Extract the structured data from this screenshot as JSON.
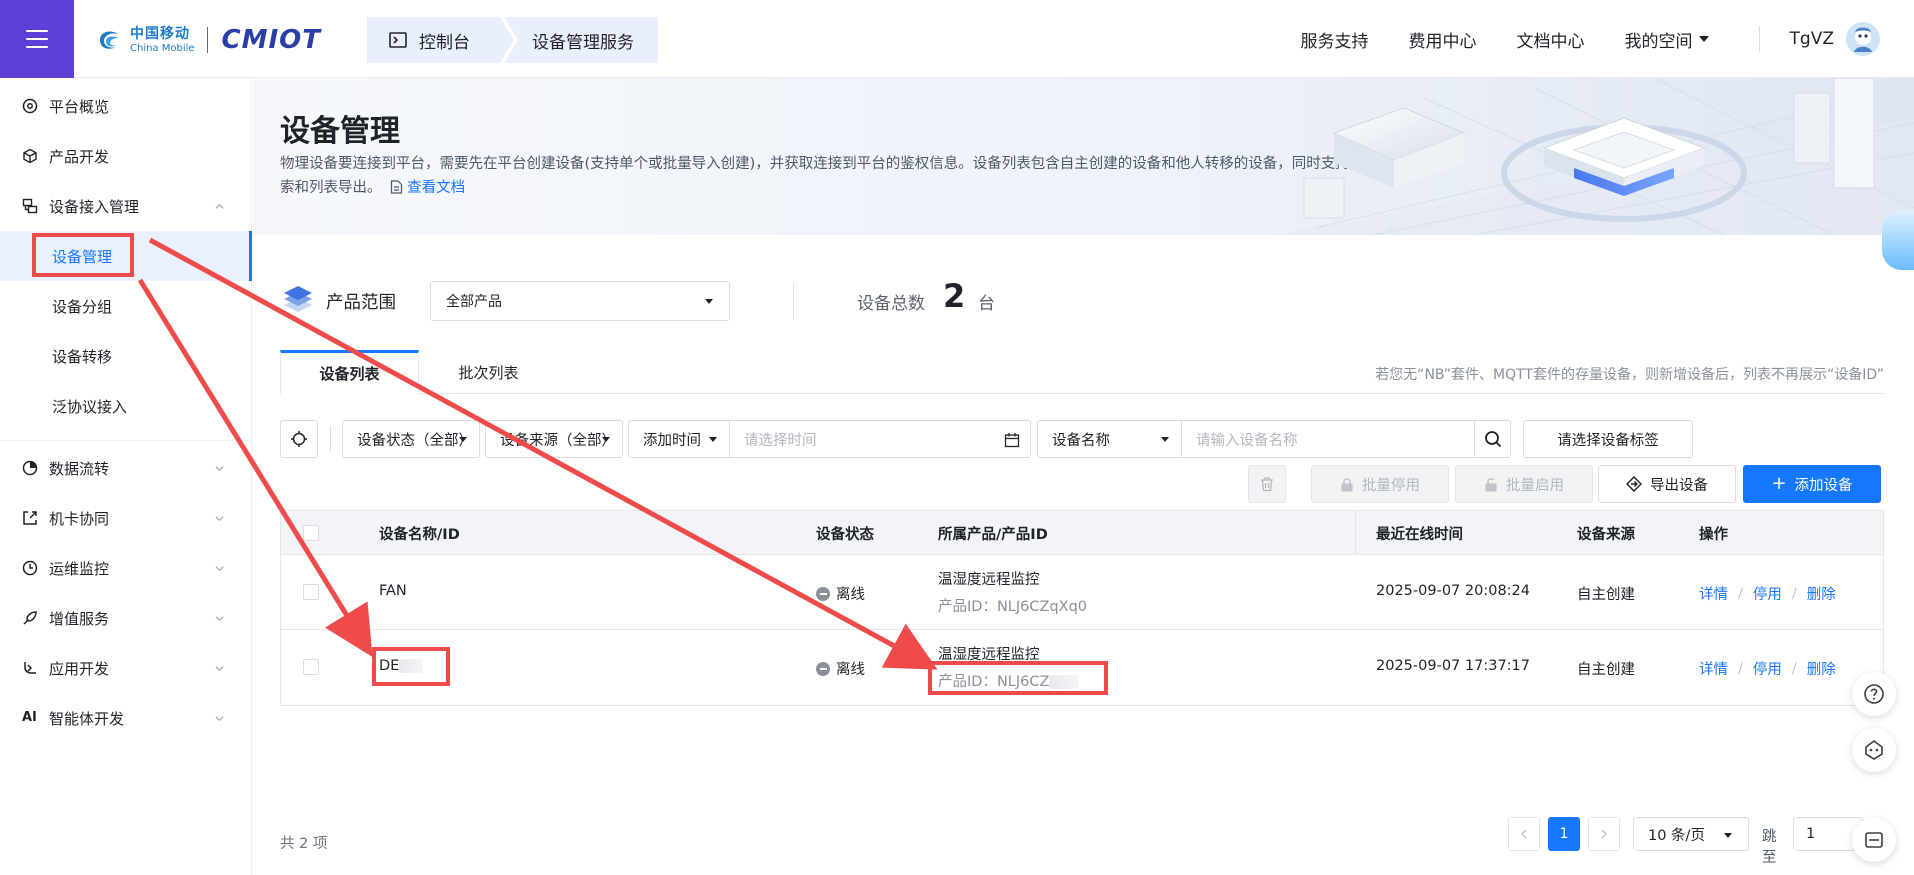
{
  "header": {
    "logo_cn": "中国移动",
    "logo_en": "China Mobile",
    "logo_product": "CMIOT",
    "breadcrumbs": [
      "控制台",
      "设备管理服务"
    ],
    "nav": [
      "服务支持",
      "费用中心",
      "文档中心",
      "我的空间"
    ],
    "username": "TgVZ"
  },
  "sidebar": {
    "items": [
      {
        "label": "平台概览",
        "icon": "overview-icon"
      },
      {
        "label": "产品开发",
        "icon": "cube-icon"
      },
      {
        "label": "设备接入管理",
        "icon": "device-access-icon",
        "expanded": true
      },
      {
        "label": "数据流转",
        "icon": "data-flow-icon"
      },
      {
        "label": "机卡协同",
        "icon": "card-sync-icon"
      },
      {
        "label": "运维监控",
        "icon": "monitor-icon"
      },
      {
        "label": "增值服务",
        "icon": "rocket-icon"
      },
      {
        "label": "应用开发",
        "icon": "app-dev-icon"
      },
      {
        "label": "智能体开发",
        "icon": "ai-icon"
      }
    ],
    "sub_items": [
      "设备管理",
      "设备分组",
      "设备转移",
      "泛协议接入"
    ],
    "active_sub": "设备管理"
  },
  "banner": {
    "title": "设备管理",
    "description": "物理设备要连接到平台，需要先在平台创建设备(支持单个或批量导入创建)，并获取连接到平台的鉴权信息。设备列表包含自主创建的设备和他人转移的设备，同时支持灵活的搜索和列表导出。",
    "doc_link": "查看文档"
  },
  "scope": {
    "label": "产品范围",
    "selected": "全部产品",
    "total_label": "设备总数",
    "total_count": "2",
    "total_unit": "台"
  },
  "tabs": {
    "device_list": "设备列表",
    "batch_list": "批次列表",
    "tip": "若您无“NB”套件、MQTT套件的存量设备，则新增设备后，列表不再展示“设备ID”"
  },
  "filters": {
    "status": "设备状态（全部）",
    "source": "设备来源（全部）",
    "time_type": "添加时间",
    "time_placeholder": "请选择时间",
    "name_type": "设备名称",
    "name_placeholder": "请输入设备名称",
    "tag": "请选择设备标签"
  },
  "actions": {
    "batch_disable": "批量停用",
    "batch_enable": "批量启用",
    "export": "导出设备",
    "add": "添加设备"
  },
  "table": {
    "columns": [
      "设备名称/ID",
      "设备状态",
      "所属产品/产品ID",
      "最近在线时间",
      "设备来源",
      "操作"
    ],
    "rows": [
      {
        "name": "FAN",
        "status": "离线",
        "product": "温湿度远程监控",
        "product_id": "产品ID：NLJ6CZqXq0",
        "last_online": "2025-09-07 20:08:24",
        "source": "自主创建"
      },
      {
        "name": "DE",
        "status": "离线",
        "product": "温湿度远程监控",
        "product_id": "产品ID：NLJ6CZ",
        "last_online": "2025-09-07 17:37:17",
        "source": "自主创建"
      }
    ],
    "ops": [
      "详情",
      "停用",
      "删除"
    ]
  },
  "pagination": {
    "total_text": "共 2 项",
    "current_page": "1",
    "page_size": "10 条/页",
    "jump_label": "跳至",
    "jump_value": "1"
  },
  "colors": {
    "primary": "#1677ff",
    "menu_purple": "#5b3fd6",
    "annotation_red": "#ef4b4b"
  }
}
